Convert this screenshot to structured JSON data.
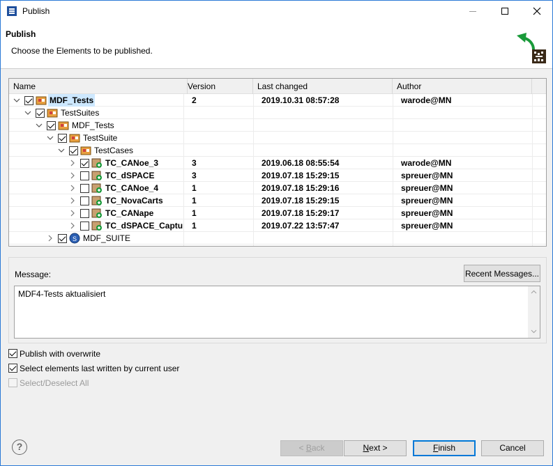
{
  "window": {
    "title": "Publish",
    "icon": "eclipse-app-icon"
  },
  "header": {
    "title": "Publish",
    "subtitle": "Choose the Elements to be published.",
    "icon": "publish-arrow-icon"
  },
  "tree": {
    "columns": [
      "Name",
      "Version",
      "Last changed",
      "Author"
    ],
    "rows": [
      {
        "name": "MDF_Tests",
        "version": "2",
        "changed": "2019.10.31 08:57:28",
        "author": "warode@MN"
      },
      {
        "name": "TestSuites",
        "version": "",
        "changed": "",
        "author": ""
      },
      {
        "name": "MDF_Tests",
        "version": "",
        "changed": "",
        "author": ""
      },
      {
        "name": "TestSuite",
        "version": "",
        "changed": "",
        "author": ""
      },
      {
        "name": "TestCases",
        "version": "",
        "changed": "",
        "author": ""
      },
      {
        "name": "TC_CANoe_3",
        "version": "3",
        "changed": "2019.06.18 08:55:54",
        "author": "warode@MN"
      },
      {
        "name": "TC_dSPACE",
        "version": "3",
        "changed": "2019.07.18 15:29:15",
        "author": "spreuer@MN"
      },
      {
        "name": "TC_CANoe_4",
        "version": "1",
        "changed": "2019.07.18 15:29:16",
        "author": "spreuer@MN"
      },
      {
        "name": "TC_NovaCarts",
        "version": "1",
        "changed": "2019.07.18 15:29:15",
        "author": "spreuer@MN"
      },
      {
        "name": "TC_CANape",
        "version": "1",
        "changed": "2019.07.18 15:29:17",
        "author": "spreuer@MN"
      },
      {
        "name": "TC_dSPACE_Capture",
        "version": "1",
        "changed": "2019.07.22 13:57:47",
        "author": "spreuer@MN"
      },
      {
        "name": "MDF_SUITE",
        "version": "",
        "changed": "",
        "author": ""
      }
    ]
  },
  "message": {
    "label": "Message:",
    "recent_button": "Recent Messages...",
    "value": "MDF4-Tests aktualisiert"
  },
  "options": {
    "overwrite": "Publish with overwrite",
    "current_user": "Select elements last written by current user",
    "select_all": "Select/Deselect All"
  },
  "buttons": {
    "back_prefix": "< ",
    "back_key": "B",
    "back_rest": "ack",
    "next_key": "N",
    "next_rest": "ext >",
    "finish_key": "F",
    "finish_rest": "inish",
    "cancel": "Cancel"
  },
  "colors": {
    "selection": "#cde8ff",
    "default_button_border": "#0078d7",
    "arrow_green": "#1a9a3a"
  }
}
